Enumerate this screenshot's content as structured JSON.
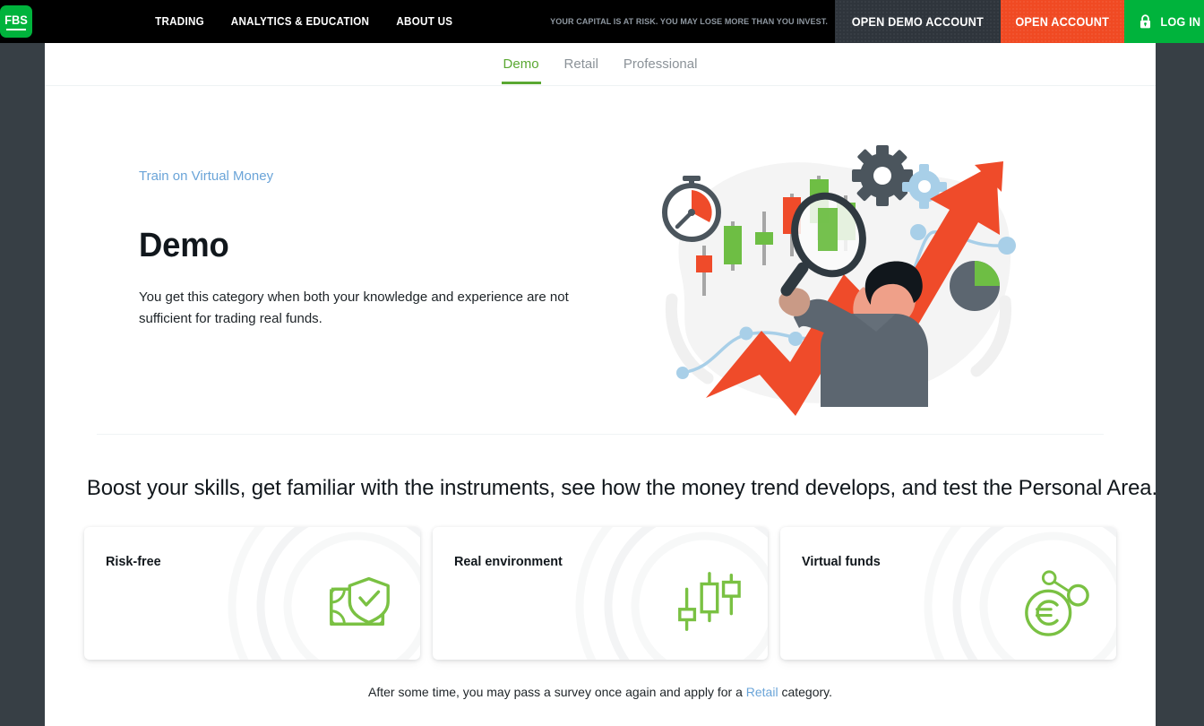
{
  "header": {
    "logo_text": "FBS",
    "nav": [
      {
        "label": "TRADING",
        "name": "nav-trading"
      },
      {
        "label": "ANALYTICS & EDUCATION",
        "name": "nav-analytics-education"
      },
      {
        "label": "ABOUT US",
        "name": "nav-about-us"
      }
    ],
    "risk_warning": "YOUR CAPITAL IS AT RISK. YOU MAY LOSE MORE THAN YOU INVEST.",
    "open_demo_account": "OPEN DEMO ACCOUNT",
    "open_account": "OPEN ACCOUNT",
    "log_in": "LOG IN",
    "colors": {
      "brand_green": "#00b33c",
      "accent_orange": "#f04a23",
      "dark": "#2f353c",
      "bar": "#000000"
    }
  },
  "tabs": {
    "items": [
      {
        "label": "Demo",
        "active": true
      },
      {
        "label": "Retail",
        "active": false
      },
      {
        "label": "Professional",
        "active": false
      }
    ],
    "active_color": "#5aa832",
    "inactive_color": "#8b9298"
  },
  "hero": {
    "eyebrow": "Train on Virtual Money",
    "title": "Demo",
    "description": "You get this category when both your knowledge and experience are not sufficient for trading real funds.",
    "illustration": "trader-with-magnifier-growth-chart-illustration"
  },
  "section": {
    "heading": "Boost your skills, get familiar with the instruments, see how the money trend develops, and test the Personal Area."
  },
  "cards": [
    {
      "title": "Risk-free",
      "icon": "banknote-shield-check-icon"
    },
    {
      "title": "Real environment",
      "icon": "candlestick-chart-icon"
    },
    {
      "title": "Virtual funds",
      "icon": "euro-coin-network-icon"
    }
  ],
  "footnote": {
    "before": "After some time, you may pass a survey once again and apply for a ",
    "link": "Retail",
    "after": " category."
  }
}
